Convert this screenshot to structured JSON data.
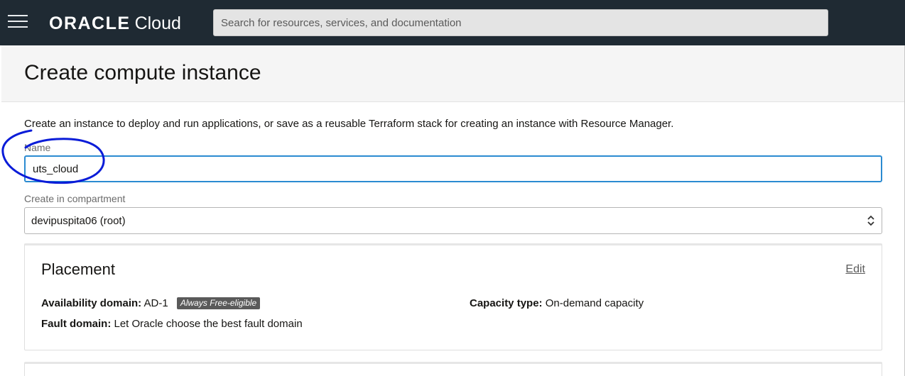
{
  "topbar": {
    "menu_icon": "hamburger-menu-icon",
    "logo_brand": "ORACLE",
    "logo_product": "Cloud",
    "search_placeholder": "Search for resources, services, and documentation"
  },
  "page": {
    "title": "Create compute instance",
    "intro": "Create an instance to deploy and run applications, or save as a reusable Terraform stack for creating an instance with Resource Manager."
  },
  "form": {
    "name_label": "Name",
    "name_value": "uts_cloud",
    "compartment_label": "Create in compartment",
    "compartment_value": "devipuspita06 (root)",
    "compartment_icon": "chevron-updown-icon"
  },
  "placement": {
    "title": "Placement",
    "edit_label": "Edit",
    "availability_domain_label": "Availability domain:",
    "availability_domain_value": "AD-1",
    "free_badge": "Always Free-eligible",
    "fault_domain_label": "Fault domain:",
    "fault_domain_value": "Let Oracle choose the best fault domain",
    "capacity_type_label": "Capacity type:",
    "capacity_type_value": "On-demand capacity"
  },
  "colors": {
    "topbar": "#1f2a33",
    "focus_border": "#2b8bd1",
    "annotation_ink": "#0a1cd8",
    "badge": "#5a5a5a"
  }
}
